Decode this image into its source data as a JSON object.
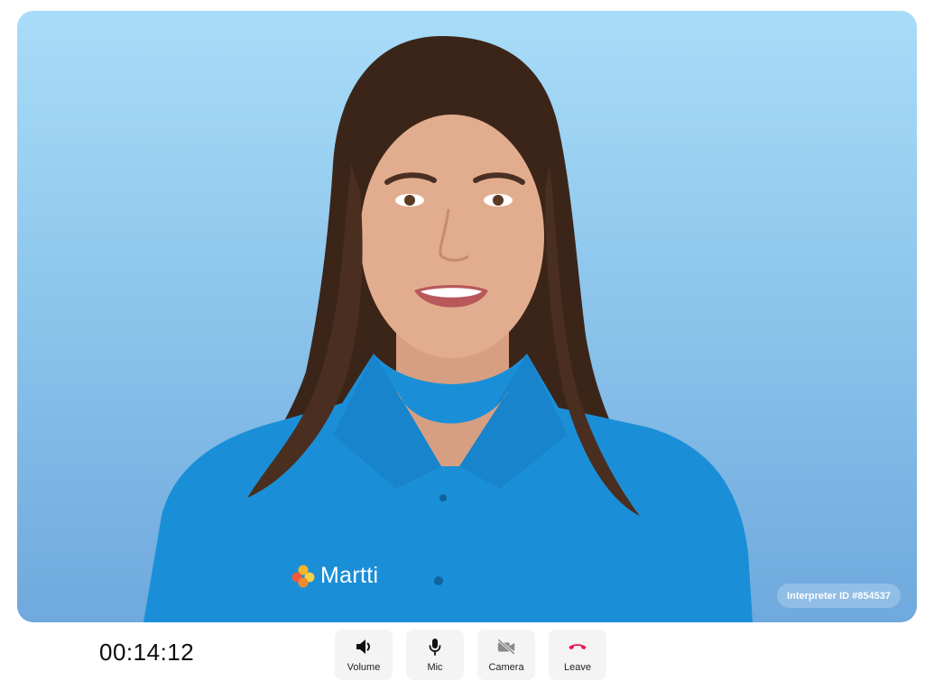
{
  "video": {
    "brand_text": "Martti",
    "interpreter_badge": "Interpreter ID #854537"
  },
  "call": {
    "timer": "00:14:12"
  },
  "controls": [
    {
      "label": "Volume",
      "icon": "volume-icon"
    },
    {
      "label": "Mic",
      "icon": "mic-icon"
    },
    {
      "label": "Camera",
      "icon": "camera-off-icon"
    },
    {
      "label": "Leave",
      "icon": "phone-hangup-icon"
    }
  ],
  "colors": {
    "background_top": "#a9dcf8",
    "background_bottom": "#6fa9dd",
    "shirt": "#1a8fd8",
    "leave_red": "#e8174f",
    "button_bg": "#f4f4f5"
  }
}
